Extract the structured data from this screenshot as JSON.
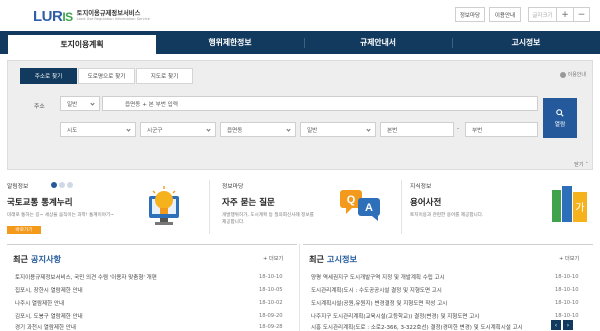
{
  "header": {
    "logo_main": "LURIS",
    "logo_line1": "토지이용규제정보서비스",
    "logo_line2": "Land Use Regulation Information Service",
    "mypage": "정보마당",
    "guide": "이용안내",
    "font_size": "글자크기",
    "plus": "+",
    "minus": "−"
  },
  "main_tabs": [
    {
      "label": "토지이용계획",
      "active": true
    },
    {
      "label": "행위제한정보",
      "active": false
    },
    {
      "label": "규제안내서",
      "active": false
    },
    {
      "label": "고시정보",
      "active": false
    }
  ],
  "search": {
    "sub_tabs": [
      {
        "label": "주소로 찾기",
        "active": true
      },
      {
        "label": "도로명으로 찾기",
        "active": false
      },
      {
        "label": "지도로 찾기",
        "active": false
      }
    ],
    "usage_guide": "이용안내",
    "address_label": "주소",
    "type_select": "일반",
    "address_placeholder": "읍면동 + 본 부번 입력",
    "sido": "시도",
    "sigungu": "시군구",
    "eupmyeondong": "읍면동",
    "ri": "일반",
    "bonbeon": "본번",
    "dash": "-",
    "bubeon": "부번",
    "search_button": "열람",
    "fold": "닫기"
  },
  "cards": {
    "notice_info": {
      "title": "알림정보",
      "head": "국토교통 통계누리",
      "desc": "미래로 통하는 길~ 세상을 움직이는 과학! 통계이야기~",
      "button": "바로가기"
    },
    "faq": {
      "title": "정보마당",
      "head": "자주 묻는 질문",
      "desc_1": "개발행위허가, 도시계획 등 질의회신사례 정보를",
      "desc_2": "제공합니다."
    },
    "dictionary": {
      "title": "지식정보",
      "head": "용어사전",
      "desc": "토지이용과 관련한 용어를 제공합니다."
    }
  },
  "notices": {
    "title_pre": "최근 ",
    "title_acc": "공지사항",
    "more": "+ 더보기",
    "rows": [
      {
        "text": "토지이용규제정보서비스, 국민 의견 수렴 '이용자 맞춤형' 개편",
        "date": "18-10-10"
      },
      {
        "text": "집포시, 장한시 열람제한 안내",
        "date": "18-10-05"
      },
      {
        "text": "나주시 열람제한 안내",
        "date": "18-10-02"
      },
      {
        "text": "김포시, 도봉구 열람제한 안내",
        "date": "18-09-20"
      },
      {
        "text": "경기 과천시 열람제한 안내",
        "date": "18-09-28"
      }
    ]
  },
  "announcements": {
    "title_pre": "최근 ",
    "title_acc": "고시정보",
    "more": "+ 더보기",
    "rows": [
      {
        "text": "양평 역세권지구 도시개발구역 지정 및 개발계획 수립 고시",
        "date": "18-10-10"
      },
      {
        "text": "도시관리계획(도시 : 수도공공시설 결정 및 지형도면 고시",
        "date": "18-10-10"
      },
      {
        "text": "도시계획시설(공원,유원지) 변경결정 및 지형도면 작성 고시",
        "date": "18-10-10"
      },
      {
        "text": "나주지구 도시관리계획(교육시설(고등학교)) 결정(변경) 및 지형도면 고시",
        "date": "18-10-10"
      },
      {
        "text": "시흥 도시관리계획(도로 : 소로2-366, 3-322호선) 결정(경미한 변경) 및 도시계획시설 고시",
        "date": "18-10-10"
      }
    ]
  },
  "colors": {
    "navy": "#123a5e",
    "accent_blue": "#245a9c",
    "orange": "#f39a1d",
    "logo_green": "#3fa34d"
  }
}
